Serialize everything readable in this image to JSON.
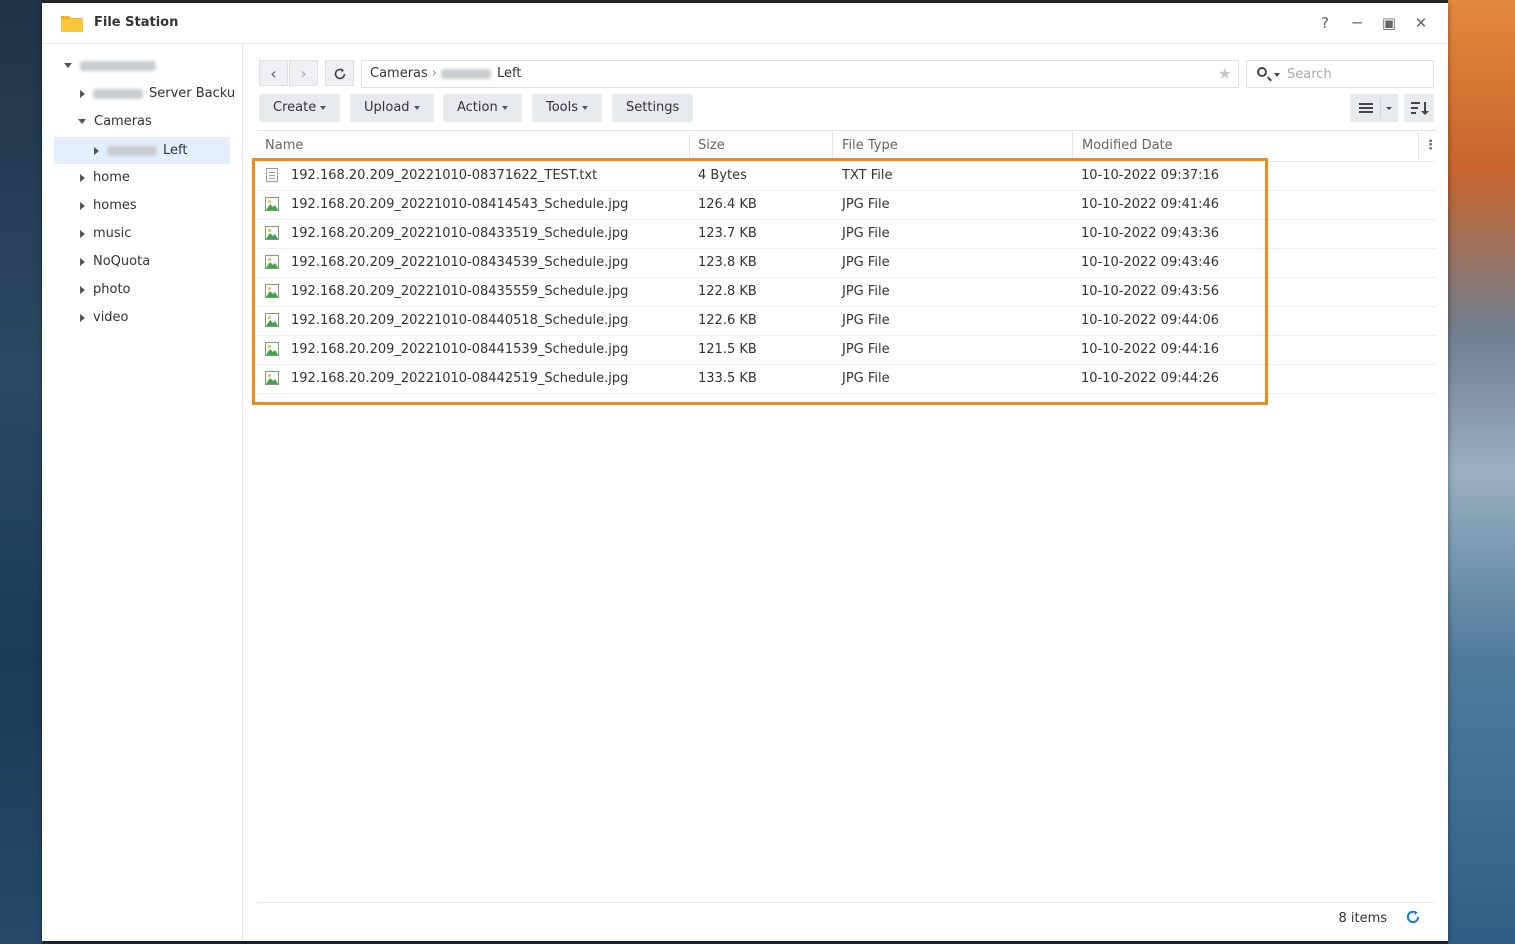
{
  "window": {
    "title": "File Station",
    "app_icon": "folder-icon"
  },
  "window_controls": {
    "help": "?",
    "minimize": "─",
    "maximize": "▣",
    "close": "✕"
  },
  "sidebar": {
    "items": [
      {
        "label": "",
        "expanded": true
      },
      {
        "label": "Server Backu",
        "expanded": false
      },
      {
        "label": "Cameras",
        "expanded": true
      },
      {
        "label": "Left",
        "expanded": false,
        "selected": true
      },
      {
        "label": "home",
        "expanded": false
      },
      {
        "label": "homes",
        "expanded": false
      },
      {
        "label": "music",
        "expanded": false
      },
      {
        "label": "NoQuota",
        "expanded": false
      },
      {
        "label": "photo",
        "expanded": false
      },
      {
        "label": "video",
        "expanded": false
      }
    ]
  },
  "nav": {
    "back": "‹",
    "forward": "›",
    "refresh_icon": "refresh-icon"
  },
  "path": {
    "segment_1": "Cameras",
    "separator": "›",
    "segment_2": "Left"
  },
  "search": {
    "placeholder": "Search"
  },
  "toolbar": {
    "create": "Create",
    "upload": "Upload",
    "action": "Action",
    "tools": "Tools",
    "settings": "Settings"
  },
  "table": {
    "columns": {
      "name": "Name",
      "size": "Size",
      "type": "File Type",
      "modified": "Modified Date"
    },
    "rows": [
      {
        "name": "192.168.20.209_20221010-08371622_TEST.txt",
        "size": "4 Bytes",
        "type": "TXT File",
        "modified": "10-10-2022 09:37:16",
        "icon": "text-file-icon"
      },
      {
        "name": "192.168.20.209_20221010-08414543_Schedule.jpg",
        "size": "126.4 KB",
        "type": "JPG File",
        "modified": "10-10-2022 09:41:46",
        "icon": "image-file-icon"
      },
      {
        "name": "192.168.20.209_20221010-08433519_Schedule.jpg",
        "size": "123.7 KB",
        "type": "JPG File",
        "modified": "10-10-2022 09:43:36",
        "icon": "image-file-icon"
      },
      {
        "name": "192.168.20.209_20221010-08434539_Schedule.jpg",
        "size": "123.8 KB",
        "type": "JPG File",
        "modified": "10-10-2022 09:43:46",
        "icon": "image-file-icon"
      },
      {
        "name": "192.168.20.209_20221010-08435559_Schedule.jpg",
        "size": "122.8 KB",
        "type": "JPG File",
        "modified": "10-10-2022 09:43:56",
        "icon": "image-file-icon"
      },
      {
        "name": "192.168.20.209_20221010-08440518_Schedule.jpg",
        "size": "122.6 KB",
        "type": "JPG File",
        "modified": "10-10-2022 09:44:06",
        "icon": "image-file-icon"
      },
      {
        "name": "192.168.20.209_20221010-08441539_Schedule.jpg",
        "size": "121.5 KB",
        "type": "JPG File",
        "modified": "10-10-2022 09:44:16",
        "icon": "image-file-icon"
      },
      {
        "name": "192.168.20.209_20221010-08442519_Schedule.jpg",
        "size": "133.5 KB",
        "type": "JPG File",
        "modified": "10-10-2022 09:44:26",
        "icon": "image-file-icon"
      }
    ]
  },
  "status": {
    "count": "8 items"
  },
  "colors": {
    "highlight": "#f08a1a",
    "selection": "#e3effc",
    "accent": "#1a7cd9"
  }
}
